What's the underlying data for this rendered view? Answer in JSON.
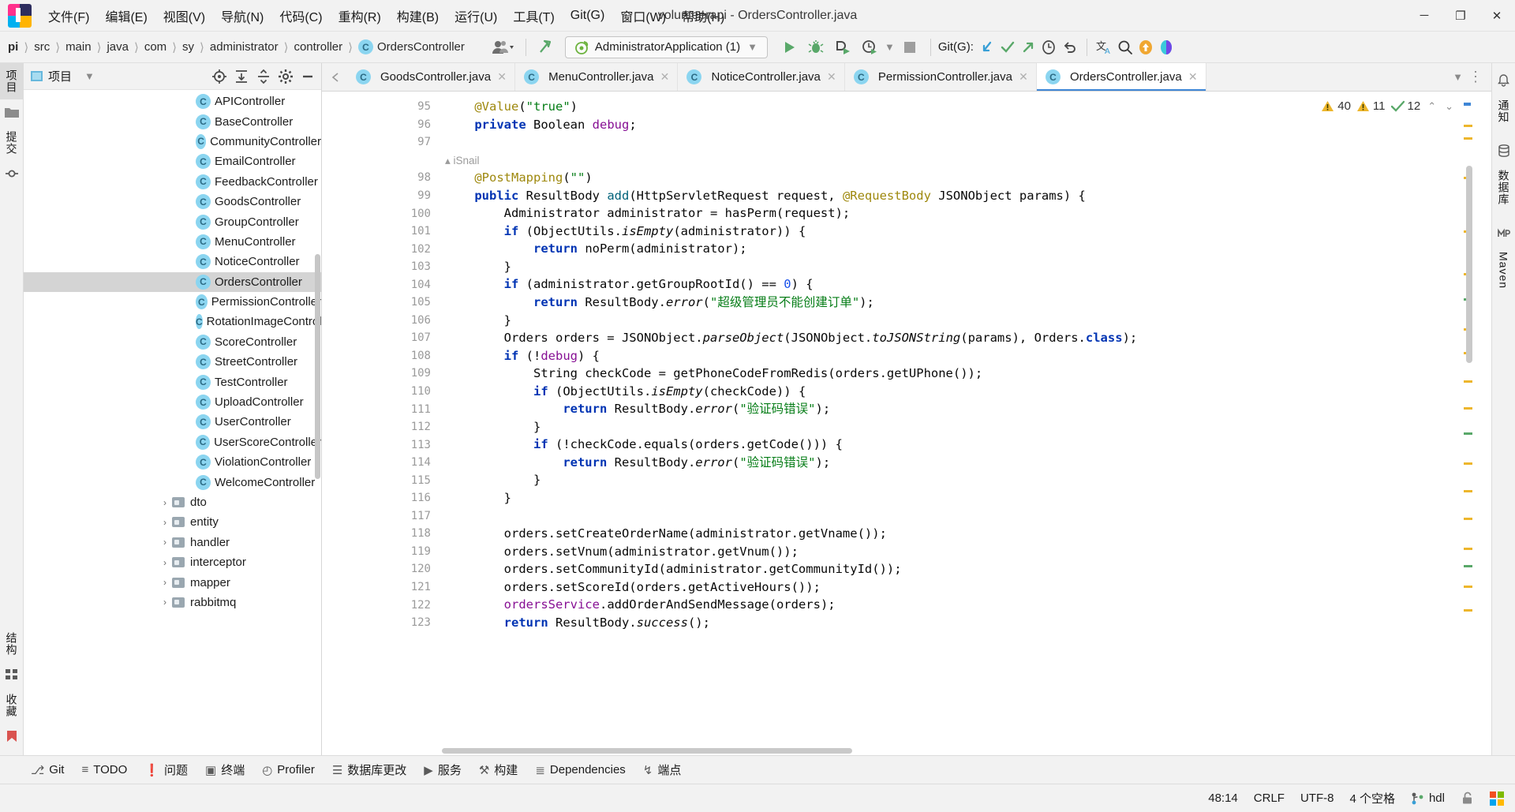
{
  "window": {
    "title": "volunteerapi - OrdersController.java",
    "minimize": "─",
    "maximize": "❐",
    "close": "✕"
  },
  "menubar": [
    {
      "label": "文件(F)",
      "name": "menu-file"
    },
    {
      "label": "编辑(E)",
      "name": "menu-edit"
    },
    {
      "label": "视图(V)",
      "name": "menu-view"
    },
    {
      "label": "导航(N)",
      "name": "menu-navigate"
    },
    {
      "label": "代码(C)",
      "name": "menu-code"
    },
    {
      "label": "重构(R)",
      "name": "menu-refactor"
    },
    {
      "label": "构建(B)",
      "name": "menu-build"
    },
    {
      "label": "运行(U)",
      "name": "menu-run"
    },
    {
      "label": "工具(T)",
      "name": "menu-tools"
    },
    {
      "label": "Git(G)",
      "name": "menu-git"
    },
    {
      "label": "窗口(W)",
      "name": "menu-window"
    },
    {
      "label": "帮助(H)",
      "name": "menu-help"
    }
  ],
  "breadcrumbs": [
    {
      "label": "pi",
      "bold": true
    },
    {
      "label": "src",
      "bold": false
    },
    {
      "label": "main",
      "bold": false
    },
    {
      "label": "java",
      "bold": false
    },
    {
      "label": "com",
      "bold": false
    },
    {
      "label": "sy",
      "bold": false
    },
    {
      "label": "administrator",
      "bold": false
    },
    {
      "label": "controller",
      "bold": false
    }
  ],
  "breadcrumb_file": "OrdersController",
  "breadcrumb_file_badge": "C",
  "toolbar": {
    "run_config": "AdministratorApplication (1)",
    "run_config_caret": "▼",
    "git_label": "Git(G):",
    "separator": "|"
  },
  "project_panel": {
    "title": "项目",
    "caret": "▼",
    "actions": [
      "locate-icon",
      "expand-all-icon",
      "collapse-all-icon",
      "settings-icon",
      "hide-icon"
    ],
    "classes": [
      "APIController",
      "BaseController",
      "CommunityController",
      "EmailController",
      "FeedbackController",
      "GoodsController",
      "GroupController",
      "MenuController",
      "NoticeController",
      "OrdersController",
      "PermissionController",
      "RotationImageControll",
      "ScoreController",
      "StreetController",
      "TestController",
      "UploadController",
      "UserController",
      "UserScoreController",
      "ViolationController",
      "WelcomeController"
    ],
    "selected_class": "OrdersController",
    "class_badge": "C",
    "folders": [
      "dto",
      "entity",
      "handler",
      "interceptor",
      "mapper",
      "rabbitmq"
    ],
    "folder_arrow": "›"
  },
  "left_stripe": {
    "tabs": [
      {
        "label": "项目",
        "active": true,
        "name": "tool-window-project"
      },
      {
        "label": "提交",
        "active": false,
        "name": "tool-window-commit"
      }
    ],
    "bottom_tabs": [
      {
        "label": "结构",
        "name": "tool-window-structure"
      },
      {
        "label": "收藏",
        "name": "tool-window-bookmarks"
      }
    ]
  },
  "right_stripe": {
    "tabs": [
      {
        "label": "通知",
        "name": "tool-window-notifications"
      },
      {
        "label": "数据库",
        "name": "tool-window-database"
      },
      {
        "label": "Maven",
        "name": "tool-window-maven"
      }
    ]
  },
  "editor_tabs": [
    {
      "label": "GoodsController.java",
      "active": false,
      "badge": "C"
    },
    {
      "label": "MenuController.java",
      "active": false,
      "badge": "C"
    },
    {
      "label": "NoticeController.java",
      "active": false,
      "badge": "C"
    },
    {
      "label": "PermissionController.java",
      "active": false,
      "badge": "C"
    },
    {
      "label": "OrdersController.java",
      "active": true,
      "badge": "C"
    }
  ],
  "editor_tabs_overflow": "▼",
  "editor_tabs_more": "⋮",
  "inspection": {
    "errors": "40",
    "warnings": "11",
    "checks": "12",
    "up": "⌃",
    "down": "⌄"
  },
  "code": {
    "author_hint": "iSnail",
    "lines": [
      {
        "num": "95",
        "html": "    <span class='ann'>@Value</span>(<span class='str'>\"true\"</span>)"
      },
      {
        "num": "96",
        "html": "    <span class='kw'>private</span> Boolean <span class='fld'>debug</span>;"
      },
      {
        "num": "97",
        "html": ""
      },
      {
        "num": "",
        "html": "__AUTHOR__"
      },
      {
        "num": "98",
        "html": "    <span class='ann'>@PostMapping</span>(<span class='str'>\"\"</span>)"
      },
      {
        "num": "99",
        "html": "    <span class='kw'>public</span> ResultBody <span class='fn'>add</span>(HttpServletRequest request, <span class='ann'>@RequestBody</span> JSONObject params) {"
      },
      {
        "num": "100",
        "html": "        Administrator administrator = hasPerm(request);"
      },
      {
        "num": "101",
        "html": "        <span class='kw'>if</span> (ObjectUtils.<span class='ital'>isEmpty</span>(administrator)) {"
      },
      {
        "num": "102",
        "html": "            <span class='kw'>return</span> noPerm(administrator);"
      },
      {
        "num": "103",
        "html": "        }"
      },
      {
        "num": "104",
        "html": "        <span class='kw'>if</span> (administrator.getGroupRootId() == <span class='num'>0</span>) {"
      },
      {
        "num": "105",
        "html": "            <span class='kw'>return</span> ResultBody.<span class='ital'>error</span>(<span class='str'>\"超级管理员不能创建订单\"</span>);"
      },
      {
        "num": "106",
        "html": "        }"
      },
      {
        "num": "107",
        "html": "        Orders orders = JSONObject.<span class='ital'>parseObject</span>(JSONObject.<span class='ital'>toJSONString</span>(params), Orders.<span class='kw'>class</span>);"
      },
      {
        "num": "108",
        "html": "        <span class='kw'>if</span> (!<span class='fld'>debug</span>) {"
      },
      {
        "num": "109",
        "html": "            String checkCode = getPhoneCodeFromRedis(orders.getUPhone());"
      },
      {
        "num": "110",
        "html": "            <span class='kw'>if</span> (ObjectUtils.<span class='ital'>isEmpty</span>(checkCode)) {"
      },
      {
        "num": "111",
        "html": "                <span class='kw'>return</span> ResultBody.<span class='ital'>error</span>(<span class='str'>\"验证码错误\"</span>);"
      },
      {
        "num": "112",
        "html": "            }"
      },
      {
        "num": "113",
        "html": "            <span class='kw'>if</span> (!checkCode.equals(orders.getCode())) {"
      },
      {
        "num": "114",
        "html": "                <span class='kw'>return</span> ResultBody.<span class='ital'>error</span>(<span class='str'>\"验证码错误\"</span>);"
      },
      {
        "num": "115",
        "html": "            }"
      },
      {
        "num": "116",
        "html": "        }"
      },
      {
        "num": "117",
        "html": ""
      },
      {
        "num": "118",
        "html": "        orders.setCreateOrderName(administrator.getVname());"
      },
      {
        "num": "119",
        "html": "        orders.setVnum(administrator.getVnum());"
      },
      {
        "num": "120",
        "html": "        orders.setCommunityId(administrator.getCommunityId());"
      },
      {
        "num": "121",
        "html": "        orders.setScoreId(orders.getActiveHours());"
      },
      {
        "num": "122",
        "html": "        <span class='fld'>ordersService</span>.addOrderAndSendMessage(orders);"
      },
      {
        "num": "123",
        "html": "        <span class='kw'>return</span> ResultBody.<span class='ital'>success</span>();"
      }
    ]
  },
  "bottom_tools": [
    {
      "label": "Git",
      "name": "bottom-tool-git"
    },
    {
      "label": "TODO",
      "name": "bottom-tool-todo"
    },
    {
      "label": "问题",
      "name": "bottom-tool-problems"
    },
    {
      "label": "终端",
      "name": "bottom-tool-terminal"
    },
    {
      "label": "Profiler",
      "name": "bottom-tool-profiler"
    },
    {
      "label": "数据库更改",
      "name": "bottom-tool-database-changes"
    },
    {
      "label": "服务",
      "name": "bottom-tool-services"
    },
    {
      "label": "构建",
      "name": "bottom-tool-build"
    },
    {
      "label": "Dependencies",
      "name": "bottom-tool-dependencies"
    },
    {
      "label": "端点",
      "name": "bottom-tool-endpoints"
    }
  ],
  "statusbar": {
    "caret": "48:14",
    "line_sep": "CRLF",
    "encoding": "UTF-8",
    "indent": "4 个空格",
    "branch": "hdl"
  },
  "colors": {
    "accent_blue": "#3e86d6",
    "class_badge": "#8bd5f0",
    "green_run": "#59a869",
    "warning_yellow": "#edb62c",
    "error_red": "#db5c5c",
    "string_green": "#067d17",
    "keyword_blue": "#0033b3"
  }
}
